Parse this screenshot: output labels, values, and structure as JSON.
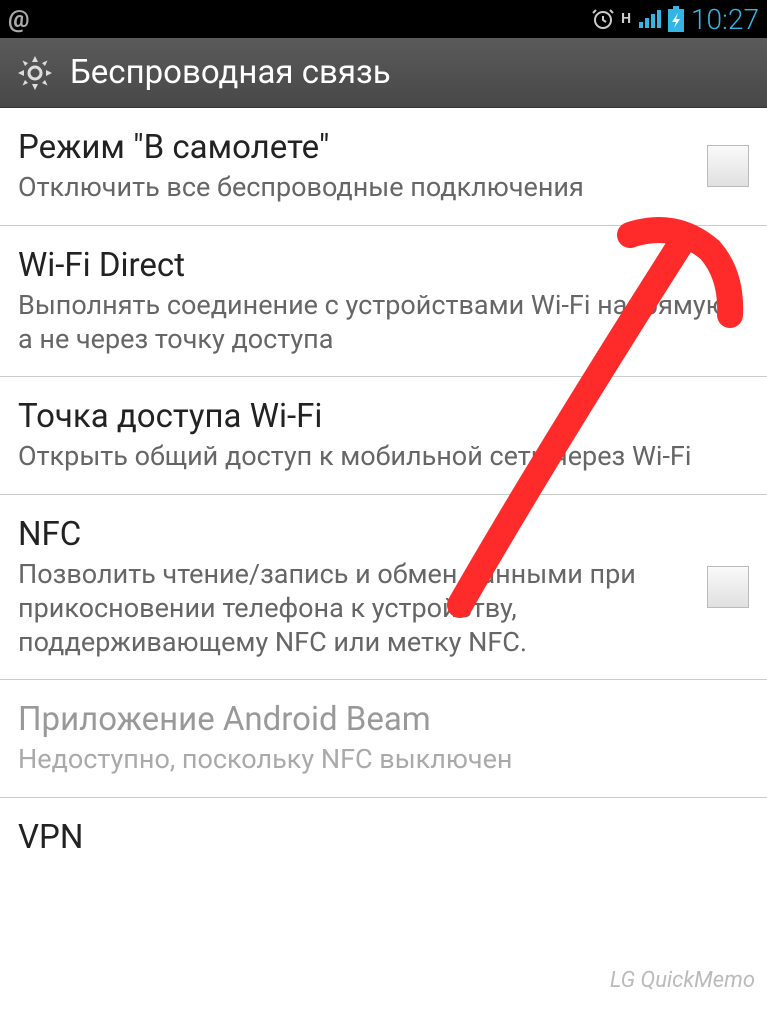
{
  "status_bar": {
    "time": "10:27",
    "network_indicator": "H"
  },
  "header": {
    "title": "Беспроводная связь"
  },
  "settings": [
    {
      "title": "Режим \"В самолете\"",
      "subtitle": "Отключить все беспроводные подключения",
      "checkbox": true
    },
    {
      "title": "Wi-Fi Direct",
      "subtitle": "Выполнять соединение  с устройствами Wi-Fi напрямую, а не через точку доступа",
      "checkbox": false
    },
    {
      "title": "Точка доступа Wi-Fi",
      "subtitle": "Открыть общий доступ к мобильной сети через Wi-Fi",
      "checkbox": false
    },
    {
      "title": "NFC",
      "subtitle": "Позволить чтение/запись и обмен данными при прикосновении телефона к устройству, поддерживающему NFC или метку NFC.",
      "checkbox": true
    },
    {
      "title": "Приложение Android Beam",
      "subtitle": "Недоступно, поскольку NFC выключен",
      "checkbox": false,
      "disabled": true
    },
    {
      "title": "VPN",
      "subtitle": "",
      "checkbox": false
    }
  ],
  "watermark": "LG QuickMemo"
}
